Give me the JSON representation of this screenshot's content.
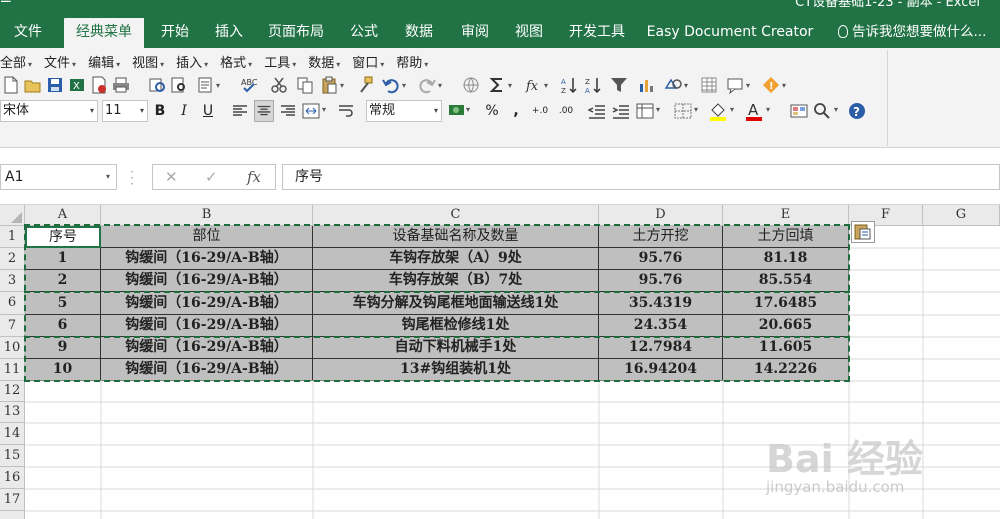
{
  "window": {
    "title": "CT设备基础1-23 - 副本 - Excel"
  },
  "tabs": [
    "文件",
    "经典菜单",
    "开始",
    "插入",
    "页面布局",
    "公式",
    "数据",
    "审阅",
    "视图",
    "开发工具",
    "Easy Document Creator"
  ],
  "active_tab": "经典菜单",
  "tell_me": "告诉我您想要做什么...",
  "menus": [
    "全部",
    "文件",
    "编辑",
    "视图",
    "插入",
    "格式",
    "工具",
    "数据",
    "窗口",
    "帮助"
  ],
  "font": {
    "name": "宋体",
    "size": "11"
  },
  "format_buttons": {
    "bold": "B",
    "italic": "I",
    "underline": "U"
  },
  "number_format": "常规",
  "number_buttons": {
    "percent": "%",
    "comma": ",",
    "inc_decimal": "+.0",
    "dec_decimal": ".00"
  },
  "namebox": "A1",
  "formula": "序号",
  "columns": [
    "A",
    "B",
    "C",
    "D",
    "E",
    "F",
    "G"
  ],
  "row_numbers": [
    "1",
    "2",
    "3",
    "6",
    "7",
    "10",
    "11",
    "12",
    "13",
    "14",
    "15",
    "16",
    "17"
  ],
  "table": {
    "headers": [
      "序号",
      "部位",
      "设备基础名称及数量",
      "土方开挖",
      "土方回填"
    ],
    "rows": [
      [
        "1",
        "钩缓间（16-29/A-B轴）",
        "车钩存放架（A）9处",
        "95.76",
        "81.18"
      ],
      [
        "2",
        "钩缓间（16-29/A-B轴）",
        "车钩存放架（B）7处",
        "95.76",
        "85.554"
      ],
      [
        "5",
        "钩缓间（16-29/A-B轴）",
        "车钩分解及钩尾框地面输送线1处",
        "35.4319",
        "17.6485"
      ],
      [
        "6",
        "钩缓间（16-29/A-B轴）",
        "钩尾框检修线1处",
        "24.354",
        "20.665"
      ],
      [
        "9",
        "钩缓间（16-29/A-B轴）",
        "自动下料机械手1处",
        "12.7984",
        "11.605"
      ],
      [
        "10",
        "钩缓间（16-29/A-B轴）",
        "13#钩组装机1处",
        "16.94204",
        "14.2226"
      ]
    ]
  },
  "watermark": {
    "brand": "Bai 经验",
    "url": "jingyan.baidu.com"
  },
  "colors": {
    "excel_green": "#217346",
    "data_fill": "#bfbfbf"
  }
}
